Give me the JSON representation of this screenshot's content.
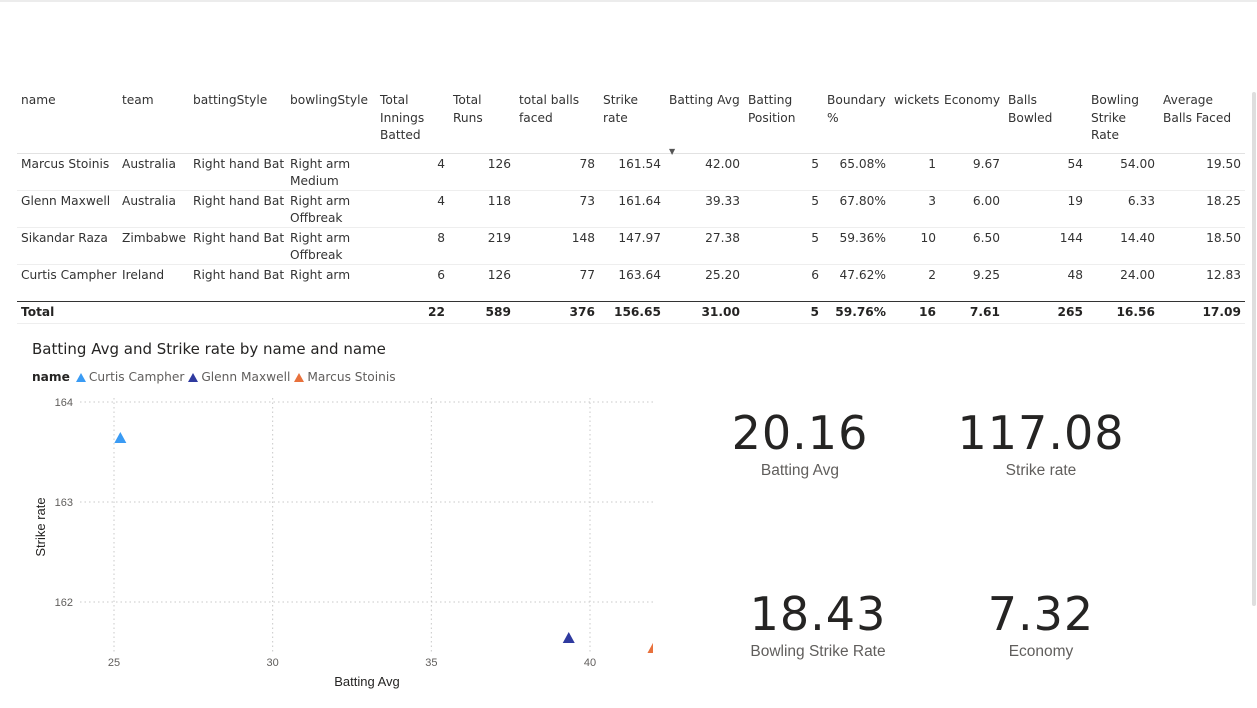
{
  "table": {
    "columns": [
      "name",
      "team",
      "battingStyle",
      "bowlingStyle",
      "Total Innings Batted",
      "Total Runs",
      "total balls faced",
      "Strike rate",
      "Batting Avg",
      "Batting Position",
      "Boundary %",
      "wickets",
      "Economy",
      "Balls Bowled",
      "Bowling Strike Rate",
      "Average Balls Faced"
    ],
    "rows": [
      [
        "Marcus Stoinis",
        "Australia",
        "Right hand Bat",
        "Right arm Medium",
        "4",
        "126",
        "78",
        "161.54",
        "42.00",
        "5",
        "65.08%",
        "1",
        "9.67",
        "54",
        "54.00",
        "19.50"
      ],
      [
        "Glenn Maxwell",
        "Australia",
        "Right hand Bat",
        "Right arm Offbreak",
        "4",
        "118",
        "73",
        "161.64",
        "39.33",
        "5",
        "67.80%",
        "3",
        "6.00",
        "19",
        "6.33",
        "18.25"
      ],
      [
        "Sikandar Raza",
        "Zimbabwe",
        "Right hand Bat",
        "Right arm Offbreak",
        "8",
        "219",
        "148",
        "147.97",
        "27.38",
        "5",
        "59.36%",
        "10",
        "6.50",
        "144",
        "14.40",
        "18.50"
      ],
      [
        "Curtis Campher",
        "Ireland",
        "Right hand Bat",
        "Right arm",
        "6",
        "126",
        "77",
        "163.64",
        "25.20",
        "6",
        "47.62%",
        "2",
        "9.25",
        "48",
        "24.00",
        "12.83"
      ]
    ],
    "total": [
      "Total",
      "",
      "",
      "",
      "22",
      "589",
      "376",
      "156.65",
      "31.00",
      "5",
      "59.76%",
      "16",
      "7.61",
      "265",
      "16.56",
      "17.09"
    ],
    "sort_icon": "sort-descending-icon"
  },
  "chart": {
    "title": "Batting Avg and Strike rate by name and name",
    "legend_title": "name",
    "legend_items": [
      {
        "label": "Curtis Campher",
        "color": "#3a9bf4"
      },
      {
        "label": "Glenn Maxwell",
        "color": "#2f3a9f"
      },
      {
        "label": "Marcus Stoinis",
        "color": "#e8713c"
      }
    ]
  },
  "chart_data": {
    "type": "scatter",
    "title": "Batting Avg and Strike rate by name and name",
    "xlabel": "Batting Avg",
    "ylabel": "Strike rate",
    "xlim": [
      24,
      41.5
    ],
    "ylim": [
      161.3,
      164
    ],
    "xticks": [
      25,
      30,
      35,
      40
    ],
    "yticks": [
      162,
      163,
      164
    ],
    "grid": true,
    "legend": "top-left",
    "series": [
      {
        "name": "Curtis Campher",
        "color": "#3a9bf4",
        "points": [
          {
            "x": 25.2,
            "y": 163.64
          }
        ]
      },
      {
        "name": "Glenn Maxwell",
        "color": "#2f3a9f",
        "points": [
          {
            "x": 39.33,
            "y": 161.64
          }
        ]
      },
      {
        "name": "Marcus Stoinis",
        "color": "#e8713c",
        "points": [
          {
            "x": 42.0,
            "y": 161.54
          }
        ]
      }
    ]
  },
  "cards": [
    {
      "value": "20.16",
      "label": "Batting Avg"
    },
    {
      "value": "117.08",
      "label": "Strike rate"
    },
    {
      "value": "18.43",
      "label": "Bowling Strike Rate"
    },
    {
      "value": "7.32",
      "label": "Economy"
    }
  ]
}
